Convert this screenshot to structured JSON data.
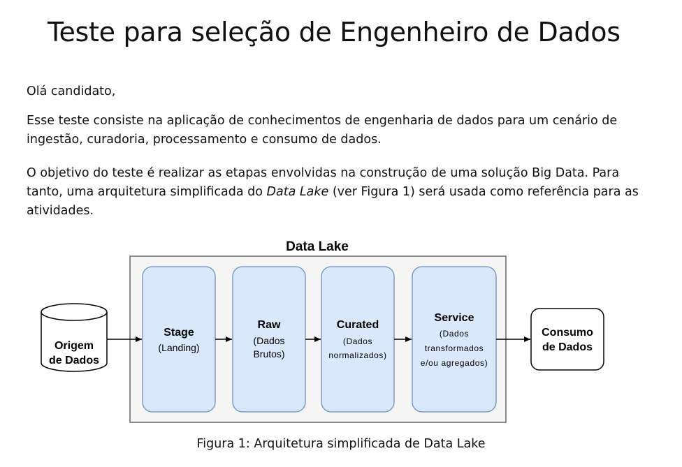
{
  "document": {
    "title": "Teste para seleção de Engenheiro de Dados",
    "greeting": "Olá candidato,",
    "paragraph2": "Esse teste consiste na aplicação de conhecimentos de engenharia de dados para um cenário de ingestão, curadoria, processamento e consumo de dados.",
    "paragraph3_before": "O objetivo do teste é realizar as etapas envolvidas na construção de uma solução Big Data. Para tanto, uma arquitetura simplificada do ",
    "paragraph3_italic": "Data Lake",
    "paragraph3_after": " (ver Figura 1) será usada como referência para as atividades.",
    "figure_caption": "Figura 1: Arquitetura simplificada de Data Lake"
  },
  "diagram": {
    "container_label": "Data Lake",
    "source": {
      "line1": "Origem",
      "line2": "de Dados"
    },
    "stages": [
      {
        "name": "Stage",
        "desc1": "(Landing)",
        "desc2": "",
        "desc3": ""
      },
      {
        "name": "Raw",
        "desc1": "(Dados",
        "desc2": "Brutos)",
        "desc3": ""
      },
      {
        "name": "Curated",
        "desc1": "(Dados",
        "desc2": "normalizados)",
        "desc3": ""
      },
      {
        "name": "Service",
        "desc1": "(Dados",
        "desc2": "transformados",
        "desc3": "e/ou agregados)"
      }
    ],
    "consumer": {
      "line1": "Consumo",
      "line2": "de Dados"
    },
    "colors": {
      "stage_fill": "#dae8fc",
      "stage_stroke": "#6c8ebf",
      "container_fill": "#f5f5f5",
      "container_stroke": "#666666"
    }
  }
}
